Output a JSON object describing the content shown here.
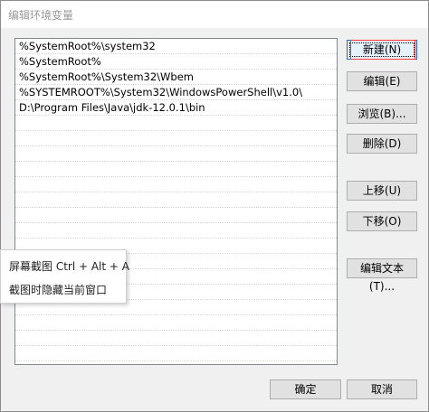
{
  "window": {
    "title": "编辑环境变量"
  },
  "paths": [
    "%SystemRoot%\\system32",
    "%SystemRoot%",
    "%SystemRoot%\\System32\\Wbem",
    "%SYSTEMROOT%\\System32\\WindowsPowerShell\\v1.0\\",
    "D:\\Program Files\\Java\\jdk-12.0.1\\bin",
    "",
    "",
    "",
    "",
    "",
    "",
    "",
    "",
    "",
    "",
    "",
    "",
    "",
    "",
    "",
    "",
    ""
  ],
  "buttons": {
    "new": "新建(N)",
    "edit": "编辑(E)",
    "browse": "浏览(B)...",
    "delete": "删除(D)",
    "move_up": "上移(U)",
    "move_down": "下移(O)",
    "edit_text": "编辑文本(T)...",
    "ok": "确定",
    "cancel": "取消"
  },
  "popup": {
    "items": [
      "屏幕截图 Ctrl + Alt + A",
      "截图时隐藏当前窗口"
    ]
  },
  "colors": {
    "accent": "#0078d7",
    "annotation": "#ff3b3b"
  }
}
